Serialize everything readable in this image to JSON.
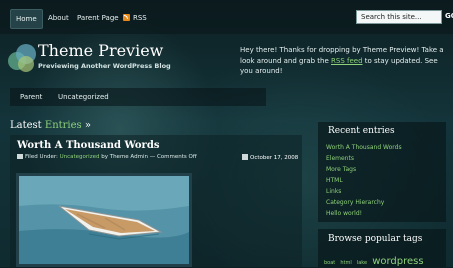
{
  "nav": {
    "items": [
      "Home",
      "About",
      "Parent Page",
      "RSS"
    ]
  },
  "search": {
    "placeholder": "Search this site...",
    "button": "GO"
  },
  "header": {
    "title": "Theme Preview",
    "tagline": "Previewing Another WordPress Blog",
    "welcome_before": "Hey there! Thanks for dropping by Theme Preview! Take a look around and grab the ",
    "welcome_link": "RSS feed",
    "welcome_after": " to stay updated. See you around!"
  },
  "categories": [
    "Parent",
    "Uncategorized"
  ],
  "latest": {
    "label": "Latest",
    "accent": "Entries",
    "arrow": "»"
  },
  "post": {
    "title": "Worth A Thousand Words",
    "filed_under": "Filed Under:",
    "category": "Uncategorized",
    "by": "by Theme Admin",
    "separator": "—",
    "comments": "Comments Off",
    "date": "October 17, 2008"
  },
  "sidebar": {
    "recent_heading": "Recent entries",
    "recent": [
      "Worth A Thousand Words",
      "Elements",
      "More Tags",
      "HTML",
      "Links",
      "Category Hierarchy",
      "Hello world!"
    ],
    "tags_heading": "Browse popular tags",
    "tags": [
      "boat",
      "html",
      "lake",
      "wordpress"
    ]
  },
  "colors": {
    "accent": "#8fd17a",
    "background": "#13343a"
  }
}
